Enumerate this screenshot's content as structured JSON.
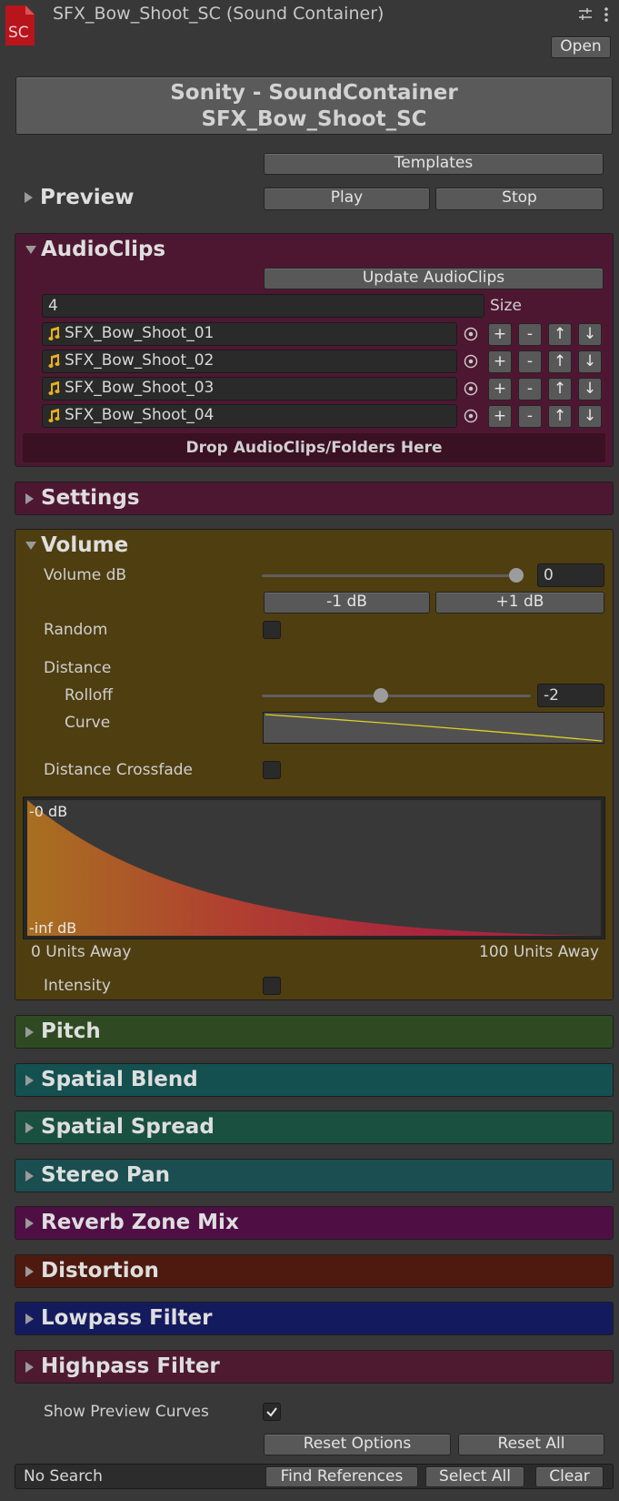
{
  "header": {
    "icon_text": "SC",
    "title": "SFX_Bow_Shoot_SC (Sound Container)",
    "open_label": "Open"
  },
  "banner": {
    "line1": "Sonity - SoundContainer",
    "line2": "SFX_Bow_Shoot_SC"
  },
  "preview": {
    "title": "Preview",
    "templates_label": "Templates",
    "play_label": "Play",
    "stop_label": "Stop"
  },
  "audioclips": {
    "title": "AudioClips",
    "update_label": "Update AudioClips",
    "size_value": "4",
    "size_label": "Size",
    "clips": [
      "SFX_Bow_Shoot_01",
      "SFX_Bow_Shoot_02",
      "SFX_Bow_Shoot_03",
      "SFX_Bow_Shoot_04"
    ],
    "row_buttons": [
      "+",
      "-",
      "↑",
      "↓"
    ],
    "drop_label": "Drop AudioClips/Folders Here"
  },
  "settings": {
    "title": "Settings"
  },
  "volume": {
    "title": "Volume",
    "volume_db_label": "Volume dB",
    "volume_db_value": "0",
    "volume_slider_fraction": 1.0,
    "minus_label": "-1 dB",
    "plus_label": "+1 dB",
    "random_label": "Random",
    "distance_label": "Distance",
    "rolloff_label": "Rolloff",
    "rolloff_value": "-2",
    "rolloff_slider_fraction": 0.44,
    "curve_label": "Curve",
    "distance_crossfade_label": "Distance Crossfade",
    "graph_top_label": "-0 dB",
    "graph_bottom_label": "-inf dB",
    "graph_left_label": "0 Units Away",
    "graph_right_label": "100 Units Away",
    "intensity_label": "Intensity"
  },
  "collapsed_sections": [
    {
      "title": "Pitch",
      "color": "#2f4a22"
    },
    {
      "title": "Spatial Blend",
      "color": "#155050"
    },
    {
      "title": "Spatial Spread",
      "color": "#1a5040"
    },
    {
      "title": "Stereo Pan",
      "color": "#1a4e50"
    },
    {
      "title": "Reverb Zone Mix",
      "color": "#4f0f45"
    },
    {
      "title": "Distortion",
      "color": "#4e1a10"
    },
    {
      "title": "Lowpass Filter",
      "color": "#141a5e"
    },
    {
      "title": "Highpass Filter",
      "color": "#4e1a30"
    }
  ],
  "footer": {
    "show_preview_curves_label": "Show Preview Curves",
    "show_preview_curves_checked": true,
    "reset_options_label": "Reset Options",
    "reset_all_label": "Reset All",
    "search_status": "No Search",
    "find_references_label": "Find References",
    "select_all_label": "Select All",
    "clear_label": "Clear"
  },
  "colors": {
    "audioclips_bg": "#4e1731",
    "settings_bg": "#4e1731",
    "volume_bg": "#4f3e10",
    "drop_bg": "#3a1023"
  }
}
